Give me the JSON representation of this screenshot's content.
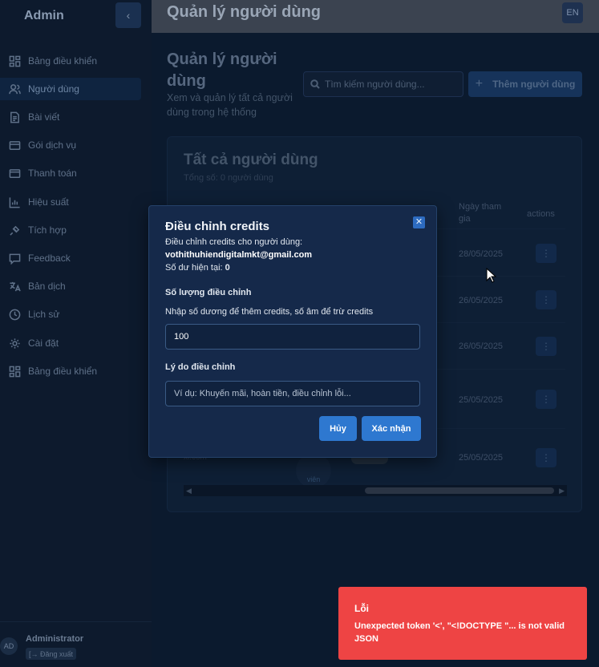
{
  "sidebar": {
    "title": "Admin",
    "collapse_icon": "chevron-left-icon",
    "items": [
      {
        "label": "Bảng điều khiển",
        "icon": "dashboard-icon",
        "active": false
      },
      {
        "label": "Người dùng",
        "icon": "users-icon",
        "active": true
      },
      {
        "label": "Bài viết",
        "icon": "document-icon",
        "active": false
      },
      {
        "label": "Gói dịch vụ",
        "icon": "card-icon",
        "active": false
      },
      {
        "label": "Thanh toán",
        "icon": "credit-card-icon",
        "active": false
      },
      {
        "label": "Hiệu suất",
        "icon": "chart-icon",
        "active": false
      },
      {
        "label": "Tích hợp",
        "icon": "plug-icon",
        "active": false
      },
      {
        "label": "Feedback",
        "icon": "message-icon",
        "active": false
      },
      {
        "label": "Bản dịch",
        "icon": "translate-icon",
        "active": false
      },
      {
        "label": "Lịch sử",
        "icon": "clock-icon",
        "active": false
      },
      {
        "label": "Cài đặt",
        "icon": "gear-icon",
        "active": false
      },
      {
        "label": "Bảng điều khiển",
        "icon": "dashboard-icon",
        "active": false
      }
    ],
    "footer": {
      "avatar": "AD",
      "name": "Administrator",
      "logout": "[→ Đăng xuất"
    }
  },
  "topbar": {
    "title": "Quản lý người dùng",
    "lang": "EN"
  },
  "page": {
    "title": "Quản lý người dùng",
    "subtitle": "Xem và quản lý tất cả người dùng trong hệ thống",
    "search_placeholder": "Tìm kiếm người dùng...",
    "add_button": "Thêm người dùng"
  },
  "card": {
    "title": "Tất cả người dùng",
    "subtitle": "Tổng số: 0 người dùng",
    "columns": {
      "joined": "Ngày tham gia",
      "actions": "actions"
    },
    "rows": [
      {
        "joined": "28/05/2025"
      },
      {
        "joined": "26/05/2025"
      },
      {
        "joined": "26/05/2025"
      },
      {
        "joined": "25/05/2025"
      },
      {
        "joined": "25/05/2025"
      }
    ],
    "partial_email": "xl.com",
    "partial_role": "viên"
  },
  "modal": {
    "title": "Điều chỉnh credits",
    "desc": "Điều chỉnh credits cho người dùng:",
    "email": "vothithuhiendigitalmkt@gmail.com",
    "balance_label": "Số dư hiện tại:",
    "balance_value": "0",
    "amount_label": "Số lượng điều chỉnh",
    "amount_hint": "Nhập số dương để thêm credits, số âm để trừ credits",
    "amount_value": "100",
    "reason_label": "Lý do điều chỉnh",
    "reason_placeholder": "Ví dụ: Khuyến mãi, hoàn tiền, điều chỉnh lỗi...",
    "cancel": "Hủy",
    "confirm": "Xác nhận"
  },
  "toast": {
    "title": "Lỗi",
    "message": "Unexpected token '<', \"<!DOCTYPE \"... is not valid JSON"
  }
}
